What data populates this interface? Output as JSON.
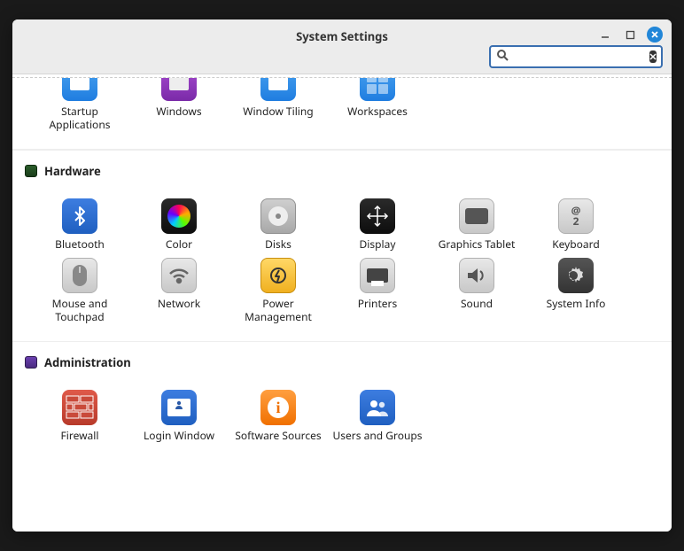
{
  "window": {
    "title": "System Settings"
  },
  "search": {
    "value": "",
    "placeholder": ""
  },
  "sections": {
    "partial": {
      "items": [
        {
          "label": "Startup Applications"
        },
        {
          "label": "Windows"
        },
        {
          "label": "Window Tiling"
        },
        {
          "label": "Workspaces"
        }
      ]
    },
    "hardware": {
      "title": "Hardware",
      "items": [
        {
          "label": "Bluetooth"
        },
        {
          "label": "Color"
        },
        {
          "label": "Disks"
        },
        {
          "label": "Display"
        },
        {
          "label": "Graphics Tablet"
        },
        {
          "label": "Keyboard"
        },
        {
          "label": "Mouse and Touchpad"
        },
        {
          "label": "Network"
        },
        {
          "label": "Power Management"
        },
        {
          "label": "Printers"
        },
        {
          "label": "Sound"
        },
        {
          "label": "System Info"
        }
      ]
    },
    "administration": {
      "title": "Administration",
      "items": [
        {
          "label": "Firewall"
        },
        {
          "label": "Login Window"
        },
        {
          "label": "Software Sources"
        },
        {
          "label": "Users and Groups"
        }
      ]
    }
  }
}
